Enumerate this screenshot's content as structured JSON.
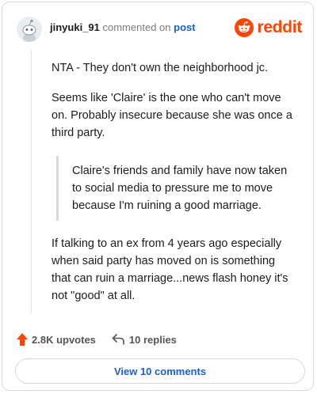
{
  "comment": {
    "username": "jinyuki_91",
    "action_text": "commented on",
    "post_link": "post",
    "brand": "reddit",
    "body": {
      "p1": "NTA - They don't own the neighborhood jc.",
      "p2": "Seems like 'Claire' is the one who can't move on. Probably insecure because she was once a third party.",
      "quote": "Claire's friends and family have now taken to social media to pressure me to move because I'm ruining a good marriage.",
      "p3": "If talking to an ex from 4 years ago especially when said party has moved on is something that can ruin a marriage...news flash honey it's not \"good\" at all."
    }
  },
  "footer": {
    "upvotes": "2.8K upvotes",
    "replies": "10 replies",
    "view_comments": "View 10 comments"
  },
  "colors": {
    "brand": "#ff4500",
    "link": "#1a5fcc"
  },
  "icons": [
    "avatar-snoo-icon",
    "reddit-logo-icon",
    "upvote-arrow-icon",
    "reply-arrow-icon"
  ]
}
